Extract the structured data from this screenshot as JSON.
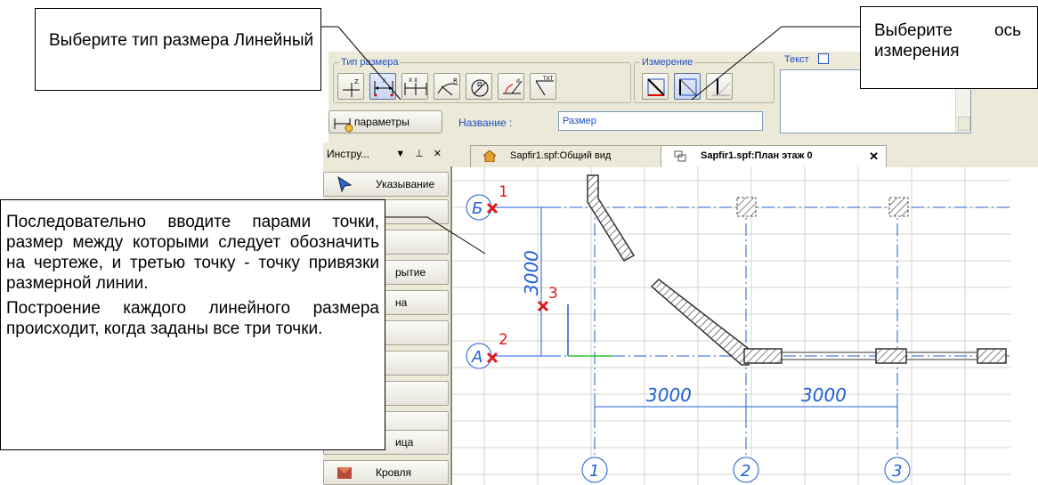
{
  "callouts": {
    "dimension_type": "Выберите тип размера Линейный",
    "axis_line1_a": "Выберите",
    "axis_line1_b": "ось",
    "axis_line2": "измерения",
    "points_instruction": "Последовательно вводите парами точки, размер между которыми следует обозначить на чертеже, и третью точку - точку привязки размерной линии.",
    "build_note": "Построение каждого линейного размера происходит, когда заданы все три точки."
  },
  "toolbar": {
    "dimension_type_group": "Тип размера",
    "measure_group": "Измерение",
    "text_group": "Текст",
    "params_label": "параметры",
    "name_label": "Название :",
    "name_value": "Размер",
    "dimension_type_buttons": [
      "Z",
      "X",
      "X X",
      "R",
      "Ø",
      "d",
      "TXT"
    ]
  },
  "instruments": {
    "header": "Инстру...",
    "header_controls": "▼ ⊥ ✕",
    "items": [
      "Указывание",
      "",
      "",
      "рытие",
      "на",
      "",
      "",
      "",
      "",
      "ица",
      "Кровля"
    ]
  },
  "tabs": [
    {
      "label": "Sapfir1.spf:Общий вид",
      "active": false
    },
    {
      "label": "Sapfir1.spf:План этаж 0",
      "active": true
    }
  ],
  "tab_close": "✕",
  "drawing": {
    "axis_labels": [
      "Б",
      "А",
      "1",
      "2",
      "3"
    ],
    "dimensions": [
      "3000",
      "3000",
      "3000"
    ],
    "point_markers": [
      "1",
      "2",
      "3"
    ],
    "colors": {
      "axis": "#1f5fd6",
      "marker": "#e01818",
      "grid": "#d6d6c8",
      "wall": "#333333"
    }
  }
}
